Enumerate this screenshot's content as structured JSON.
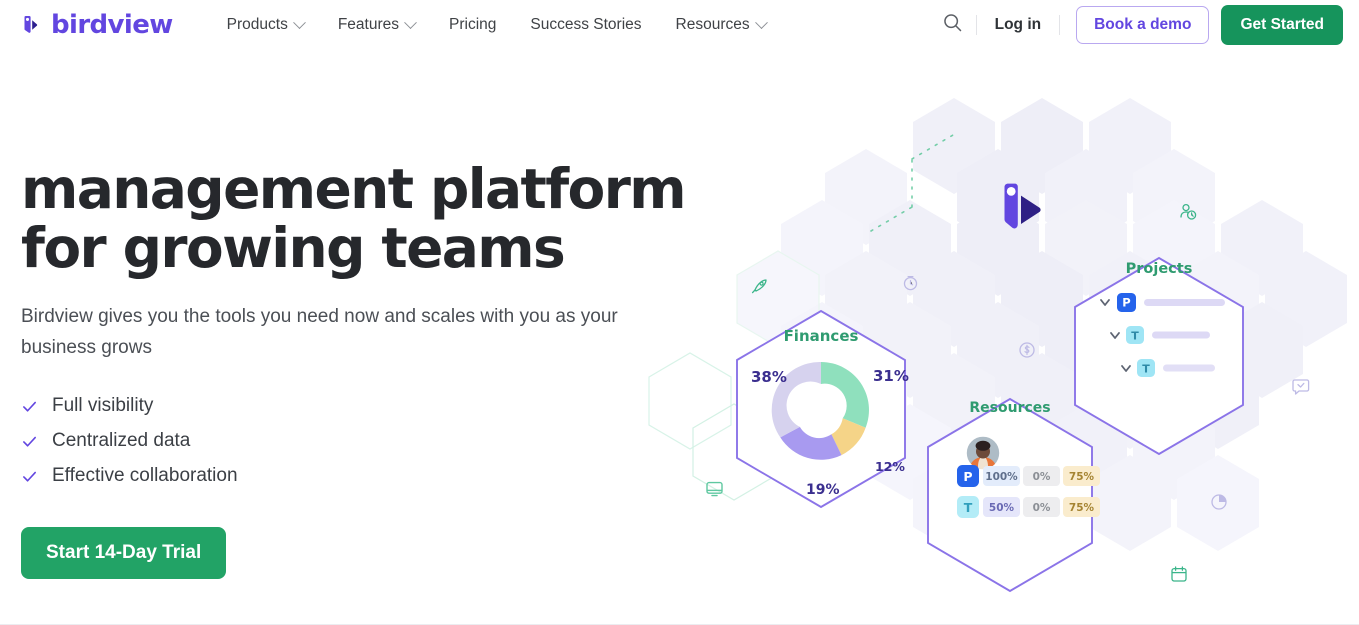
{
  "brand": {
    "name": "birdview",
    "logo_icon": "birdview-bird-logo",
    "purple": "#6246e0",
    "green": "#16945c"
  },
  "header": {
    "nav": [
      {
        "label": "Products",
        "has_caret": true,
        "icon": "chevron-down-icon"
      },
      {
        "label": "Features",
        "has_caret": true,
        "icon": "chevron-down-icon"
      },
      {
        "label": "Pricing",
        "has_caret": false,
        "icon": ""
      },
      {
        "label": "Success Stories",
        "has_caret": false,
        "icon": ""
      },
      {
        "label": "Resources",
        "has_caret": true,
        "icon": "chevron-down-icon"
      }
    ],
    "search_icon": "search-icon",
    "login_label": "Log in",
    "demo_label": "Book a demo",
    "get_started_label": "Get Started"
  },
  "hero": {
    "headline_line1": "management platform",
    "headline_line2": "for growing teams",
    "subcopy": "Birdview gives you the tools you need now and scales with you as your business grows",
    "checklist": [
      {
        "label": "Full visibility",
        "icon": "check-icon"
      },
      {
        "label": "Centralized data",
        "icon": "check-icon"
      },
      {
        "label": "Effective collaboration",
        "icon": "check-icon"
      }
    ],
    "cta_label": "Start 14-Day Trial"
  },
  "illustration": {
    "bird_mascot_icon": "birdview-bird-mascot",
    "hex_icons": [
      {
        "name": "rocket-icon",
        "color": "#3bb58a"
      },
      {
        "name": "stopwatch-icon",
        "color": "#b9b6e4"
      },
      {
        "name": "dollar-circle-icon",
        "color": "#b9b6e4"
      },
      {
        "name": "user-clock-icon",
        "color": "#3bb58a"
      },
      {
        "name": "chat-bubble-icon",
        "color": "#b9b6e4"
      },
      {
        "name": "pie-chart-icon",
        "color": "#b9b6e4"
      },
      {
        "name": "calendar-icon",
        "color": "#3bb58a"
      },
      {
        "name": "monitor-icon",
        "color": "#5ec8a0"
      }
    ],
    "finances_card": {
      "title": "Finances",
      "labels": [
        "38%",
        "31%",
        "12%",
        "19%"
      ]
    },
    "projects_card": {
      "title": "Projects",
      "rows": [
        {
          "badge": "P",
          "badge_color": "#2563eb",
          "icon": "chevron-down-icon"
        },
        {
          "badge": "T",
          "badge_color": "#9fe5f5",
          "icon": "chevron-down-icon"
        },
        {
          "badge": "T",
          "badge_color": "#9fe5f5",
          "icon": "chevron-down-icon"
        }
      ]
    },
    "resources_card": {
      "title": "Resources",
      "avatar_icon": "user-avatar",
      "rows": [
        {
          "badge": "P",
          "badge_color": "#2563eb",
          "cells": [
            "100%",
            "0%",
            "75%"
          ]
        },
        {
          "badge": "T",
          "badge_color": "#b3ecf7",
          "cells": [
            "50%",
            "0%",
            "75%"
          ]
        }
      ]
    }
  },
  "chart_data": {
    "type": "pie",
    "title": "Finances",
    "labels": [
      "38%",
      "31%",
      "12%",
      "19%"
    ],
    "values": [
      38,
      31,
      12,
      19
    ],
    "colors": [
      "#d6d2ee",
      "#8fe0bd",
      "#f5d488",
      "#a89af0"
    ],
    "legend": "none",
    "donut": true
  }
}
